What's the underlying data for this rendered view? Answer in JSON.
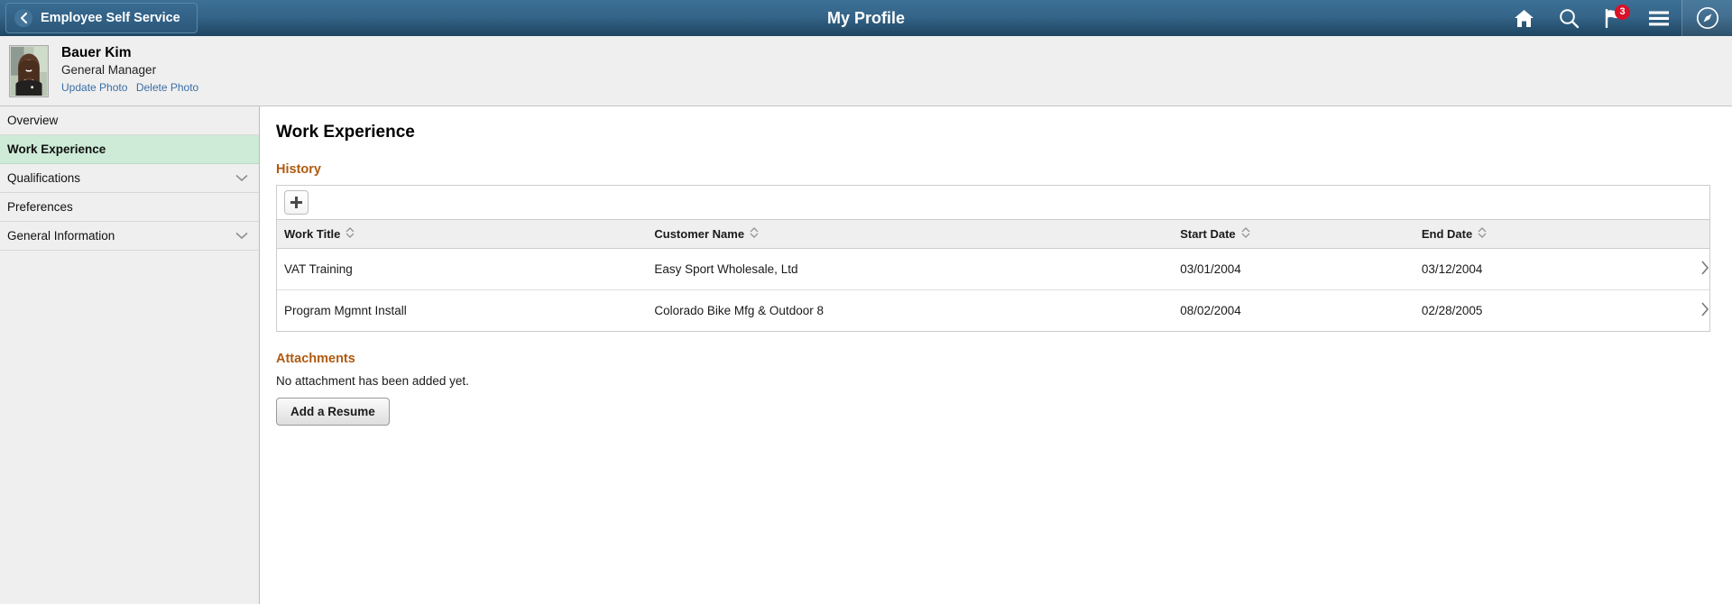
{
  "header": {
    "back_label": "Employee Self Service",
    "back_icon": "chevron-left-icon",
    "title": "My Profile",
    "icons": [
      {
        "name": "home-icon",
        "label": "Home"
      },
      {
        "name": "search-icon",
        "label": "Search"
      },
      {
        "name": "notifications-flag-icon",
        "label": "Notifications",
        "badge": "3"
      },
      {
        "name": "actions-menu-icon",
        "label": "Actions List"
      },
      {
        "name": "nav-bar-compass-icon",
        "label": "NavBar"
      }
    ]
  },
  "profile": {
    "name": "Bauer Kim",
    "role": "General Manager",
    "update_photo": "Update Photo",
    "delete_photo": "Delete Photo"
  },
  "sidebar": {
    "items": [
      {
        "label": "Overview",
        "selected": false,
        "expandable": false
      },
      {
        "label": "Work Experience",
        "selected": true,
        "expandable": false
      },
      {
        "label": "Qualifications",
        "selected": false,
        "expandable": true
      },
      {
        "label": "Preferences",
        "selected": false,
        "expandable": false
      },
      {
        "label": "General Information",
        "selected": false,
        "expandable": true
      }
    ]
  },
  "main": {
    "page_heading": "Work Experience",
    "history_heading": "History",
    "add_button_label": "+",
    "columns": [
      "Work Title",
      "Customer Name",
      "Start Date",
      "End Date"
    ],
    "rows": [
      {
        "work_title": "VAT Training",
        "customer_name": "Easy Sport Wholesale, Ltd",
        "start_date": "03/01/2004",
        "end_date": "03/12/2004"
      },
      {
        "work_title": "Program Mgmnt Install",
        "customer_name": "Colorado Bike Mfg & Outdoor  8",
        "start_date": "08/02/2004",
        "end_date": "02/28/2005"
      }
    ],
    "attachments_heading": "Attachments",
    "attachments_note": "No attachment has been added yet.",
    "add_resume_label": "Add a Resume"
  },
  "colors": {
    "header_top": "#3c7096",
    "header_bottom": "#1e4561",
    "selected_nav": "#cdebd7",
    "subheading": "#b05a11",
    "badge": "#d81228",
    "link": "#3a6ea5"
  }
}
